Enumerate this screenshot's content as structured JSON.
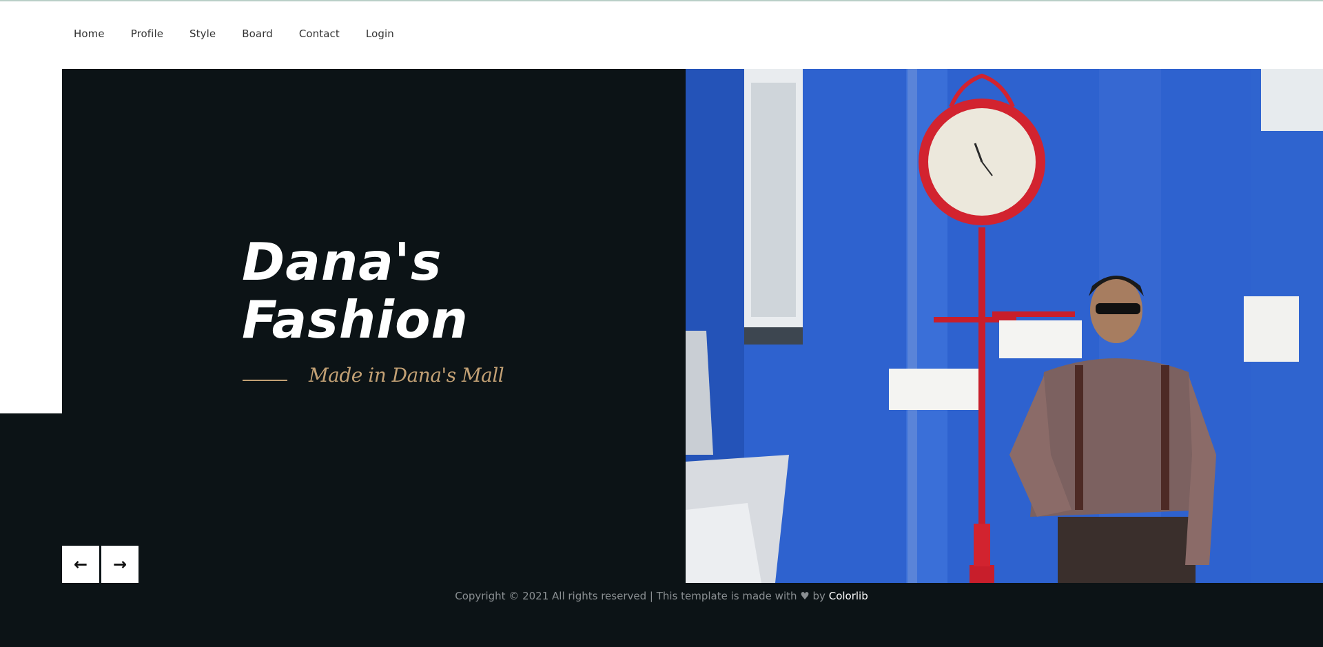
{
  "nav": {
    "items": [
      {
        "label": "Home"
      },
      {
        "label": "Profile"
      },
      {
        "label": "Style"
      },
      {
        "label": "Board"
      },
      {
        "label": "Contact"
      },
      {
        "label": "Login"
      }
    ]
  },
  "hero": {
    "title_line1": "Dana's",
    "title_line2": "Fashion",
    "tagline": "Made in Dana's Mall",
    "accent_color": "#c2a074",
    "prev_icon": "arrow-left-icon",
    "next_icon": "arrow-right-icon",
    "prev_glyph": "←",
    "next_glyph": "→"
  },
  "footer": {
    "text_before": "Copyright © 2021 All rights reserved | This template is made with",
    "heart_glyph": "♥",
    "by": "by",
    "link_text": "Colorlib"
  },
  "colors": {
    "dark_bg": "#0c1316",
    "photo_blue": "#2e62cf",
    "clock_red": "#d2232f"
  }
}
